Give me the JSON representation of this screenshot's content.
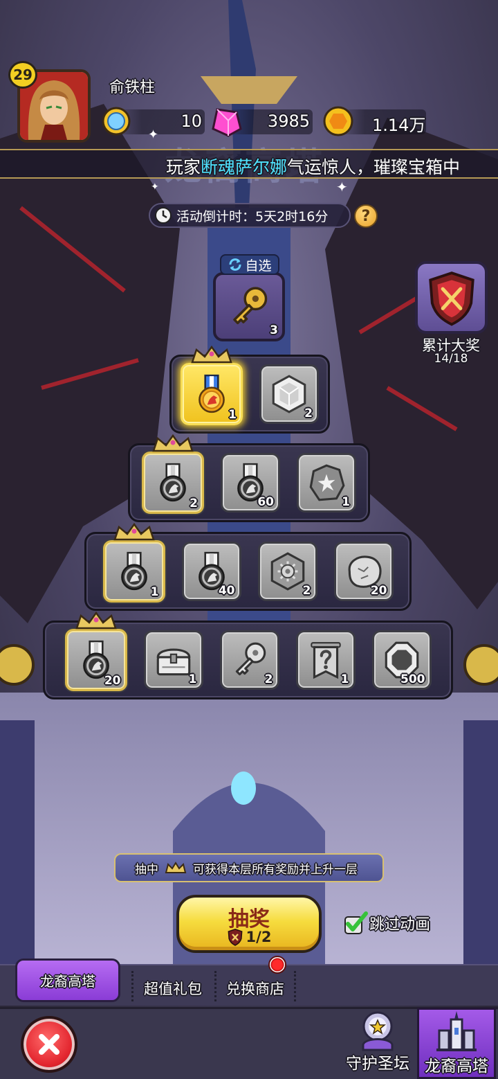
{
  "player": {
    "level": "29",
    "name": "俞铁柱"
  },
  "currencies": [
    {
      "icon": "blue-gem-icon",
      "value": "10"
    },
    {
      "icon": "pink-crystal-icon",
      "value": "3985"
    },
    {
      "icon": "gold-coin-icon",
      "value": "1.14万"
    }
  ],
  "event_title": "龙裔高塔",
  "ticker": {
    "prefix": "玩家",
    "highlight": "断魂萨尔娜",
    "suffix": "气运惊人，璀璨宝箱中"
  },
  "countdown": {
    "label": "活动倒计时：5天2时16分"
  },
  "help_label": "?",
  "select_slot": {
    "label": "自选",
    "icon": "gold-key-icon",
    "count": "3"
  },
  "cumulative": {
    "label": "累计大奖",
    "progress": "14/18"
  },
  "tiers": [
    {
      "items": [
        {
          "icon": "gold-medal-icon",
          "count": "1",
          "crown": true,
          "current": true
        },
        {
          "icon": "hex-gem-icon",
          "count": "2"
        }
      ]
    },
    {
      "items": [
        {
          "icon": "medal-icon",
          "count": "2",
          "crown": true
        },
        {
          "icon": "medal-icon",
          "count": "60"
        },
        {
          "icon": "rune-stone-icon",
          "count": "1"
        }
      ]
    },
    {
      "items": [
        {
          "icon": "medal-icon",
          "count": "1",
          "crown": true
        },
        {
          "icon": "medal-icon",
          "count": "40"
        },
        {
          "icon": "hex-gear-icon",
          "count": "2"
        },
        {
          "icon": "rock-icon",
          "count": "20"
        }
      ]
    },
    {
      "items": [
        {
          "icon": "medal-icon",
          "count": "20",
          "crown": true
        },
        {
          "icon": "chest-icon",
          "count": "1"
        },
        {
          "icon": "key-icon",
          "count": "2"
        },
        {
          "icon": "mystery-banner-icon",
          "count": "1"
        },
        {
          "icon": "octagon-coin-icon",
          "count": "500"
        }
      ]
    }
  ],
  "hint": {
    "prefix": "抽中",
    "suffix": "可获得本层所有奖励并上升一层"
  },
  "draw": {
    "label": "抽奖",
    "cost": "1/2"
  },
  "skip": {
    "label": "跳过动画",
    "checked": true
  },
  "tabs": [
    {
      "label": "龙裔高塔",
      "active": true
    },
    {
      "label": "超值礼包"
    },
    {
      "label": "兑换商店",
      "notification": true
    }
  ],
  "bottom_nav": [
    {
      "label": "守护圣坛"
    },
    {
      "label": "龙裔高塔",
      "active": true
    }
  ],
  "colors": {
    "accent": "#f3cf22",
    "highlight_text": "#4fe3ff",
    "active_tab": "#a45ae8",
    "close": "#e3262f"
  }
}
